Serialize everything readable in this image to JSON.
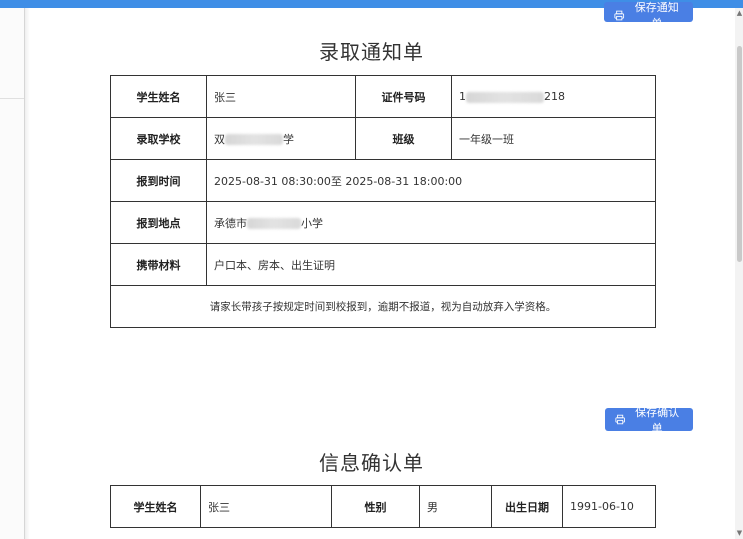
{
  "notice": {
    "save_button_label": "保存通知单",
    "title": "录取通知单",
    "rows": {
      "student_name_label": "学生姓名",
      "student_name": "张三",
      "id_number_label": "证件号码",
      "id_number_prefix": "1",
      "id_number_suffix": "218",
      "school_label": "录取学校",
      "school_prefix": "双",
      "school_suffix": "学",
      "class_label": "班级",
      "class_value": "一年级一班",
      "time_label": "报到时间",
      "time_value": "2025-08-31 08:30:00至 2025-08-31 18:00:00",
      "place_label": "报到地点",
      "place_prefix": "承德市",
      "place_suffix": "小学",
      "materials_label": "携带材料",
      "materials_value": "户口本、房本、出生证明"
    },
    "notice_text": "请家长带孩子按规定时间到校报到，逾期不报道，视为自动放弃入学资格。"
  },
  "confirm": {
    "save_button_label": "保存确认单",
    "title": "信息确认单",
    "student_name_label": "学生姓名",
    "student_name": "张三",
    "gender_label": "性别",
    "gender": "男",
    "birth_label": "出生日期",
    "birth_date": "1991-06-10"
  },
  "icons": {
    "save": "printer-icon"
  },
  "colors": {
    "accent": "#4a7fe4",
    "top_bar": "#3f8ee6"
  }
}
